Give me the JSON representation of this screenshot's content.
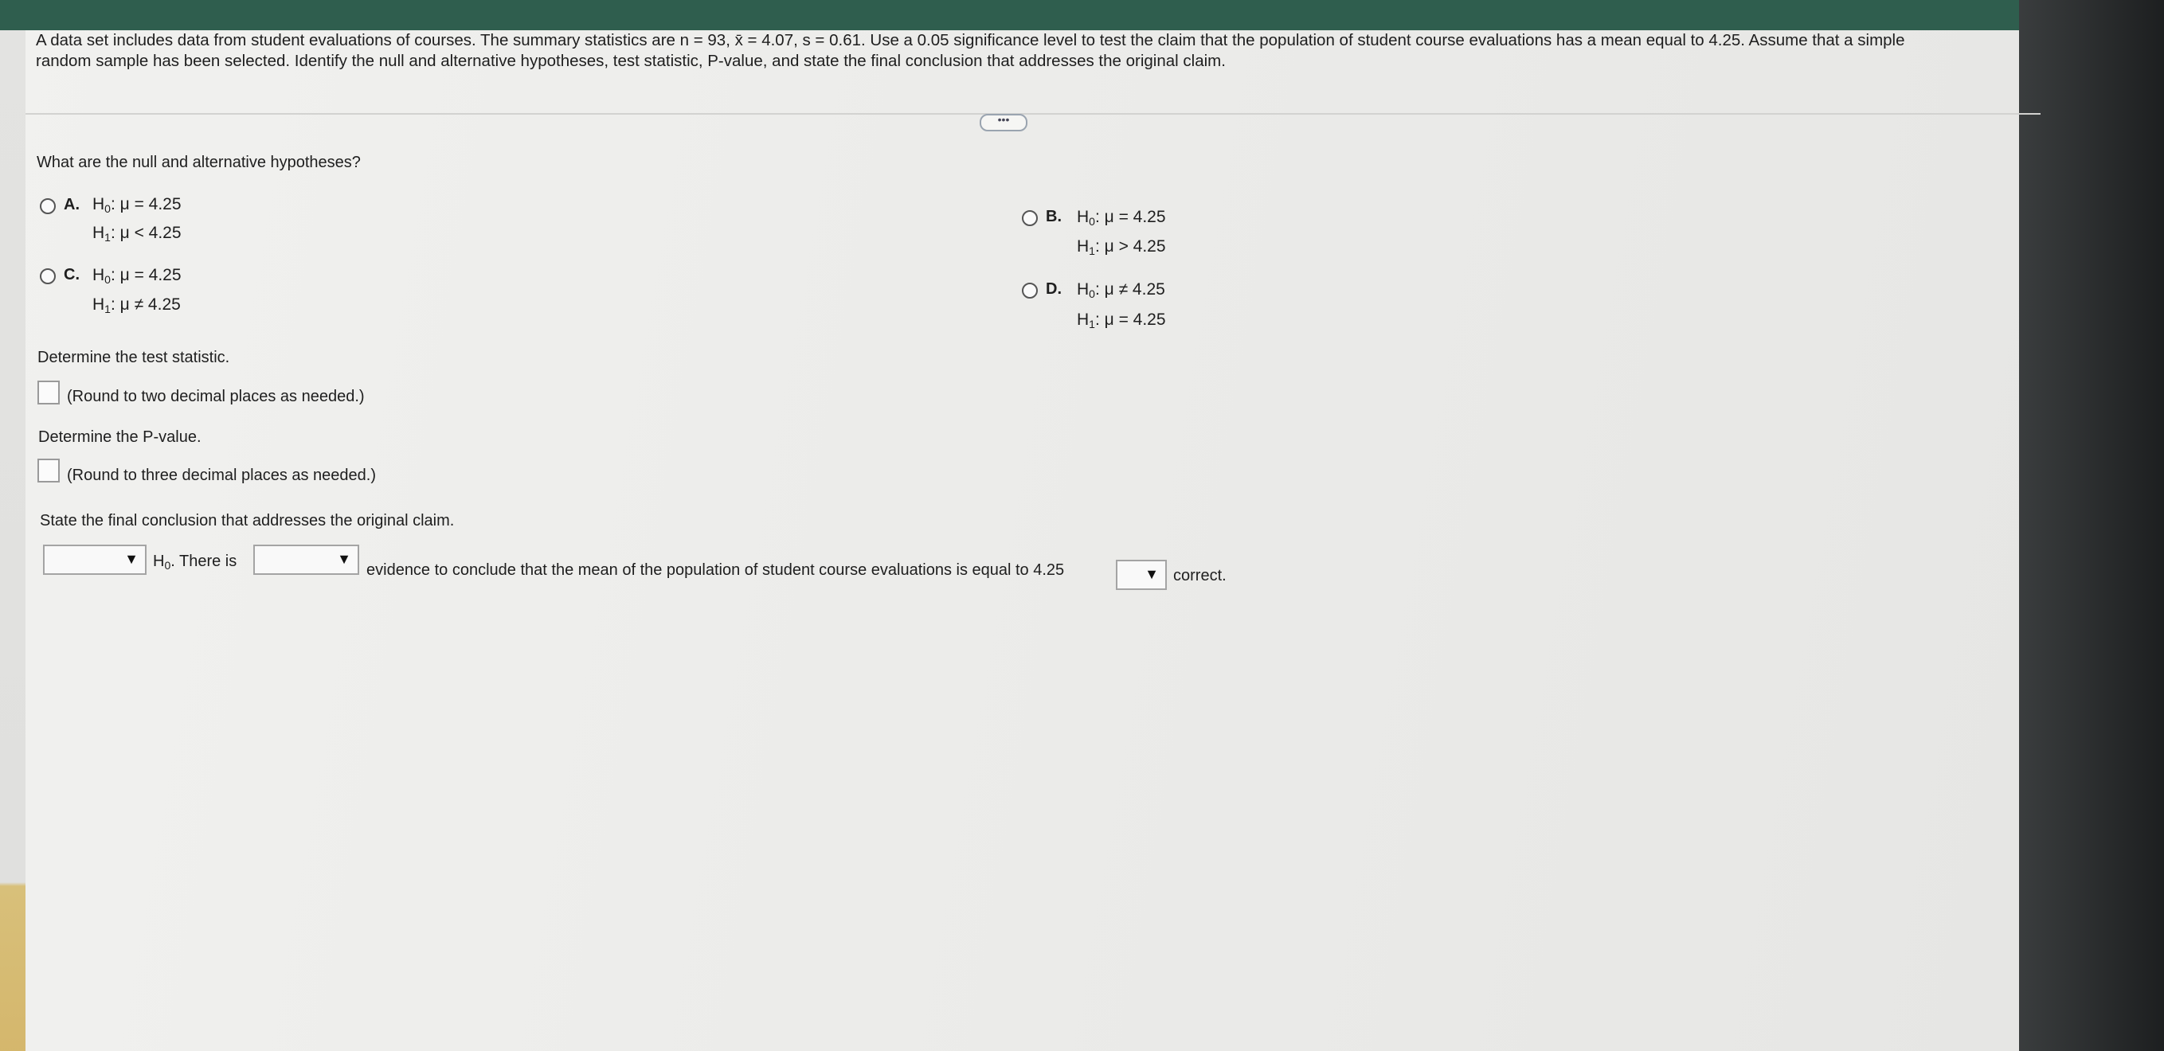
{
  "problem": {
    "line1": "A data set includes data from student evaluations of courses. The summary statistics are n = 93, x̄ = 4.07, s = 0.61. Use a 0.05 significance level to test the claim that the population of student course evaluations has a mean equal to 4.25. Assume that a simple",
    "line2": "random sample has been selected. Identify the null and alternative hypotheses, test statistic, P-value, and state the final conclusion that addresses the original claim."
  },
  "more_label": "•••",
  "q1": {
    "prompt": "What are the null and alternative hypotheses?",
    "options": [
      {
        "letter": "A.",
        "h0_label": "H",
        "h0_sub": "0",
        "h0_rel": ": μ = 4.25",
        "h1_label": "H",
        "h1_sub": "1",
        "h1_rel": ": μ < 4.25"
      },
      {
        "letter": "B.",
        "h0_label": "H",
        "h0_sub": "0",
        "h0_rel": ": μ = 4.25",
        "h1_label": "H",
        "h1_sub": "1",
        "h1_rel": ": μ > 4.25"
      },
      {
        "letter": "C.",
        "h0_label": "H",
        "h0_sub": "0",
        "h0_rel": ": μ = 4.25",
        "h1_label": "H",
        "h1_sub": "1",
        "h1_rel": ": μ ≠ 4.25"
      },
      {
        "letter": "D.",
        "h0_label": "H",
        "h0_sub": "0",
        "h0_rel": ": μ ≠ 4.25",
        "h1_label": "H",
        "h1_sub": "1",
        "h1_rel": ": μ = 4.25"
      }
    ]
  },
  "q2": {
    "prompt": "Determine the test statistic.",
    "hint": "(Round to two decimal places as needed.)",
    "value": ""
  },
  "q3": {
    "prompt": "Determine the P-value.",
    "hint": "(Round to three decimal places as needed.)",
    "value": ""
  },
  "q4": {
    "prompt": "State the final conclusion that addresses the original claim.",
    "h_label": "H",
    "h_sub": "0",
    "text_there_is": ". There is",
    "text_middle": "evidence to conclude that the mean of the population of student course evaluations is equal to 4.25",
    "text_end": "correct.",
    "dropdown1_value": "",
    "dropdown2_value": "",
    "dropdown3_value": "",
    "dropdown_arrow": "▼"
  }
}
